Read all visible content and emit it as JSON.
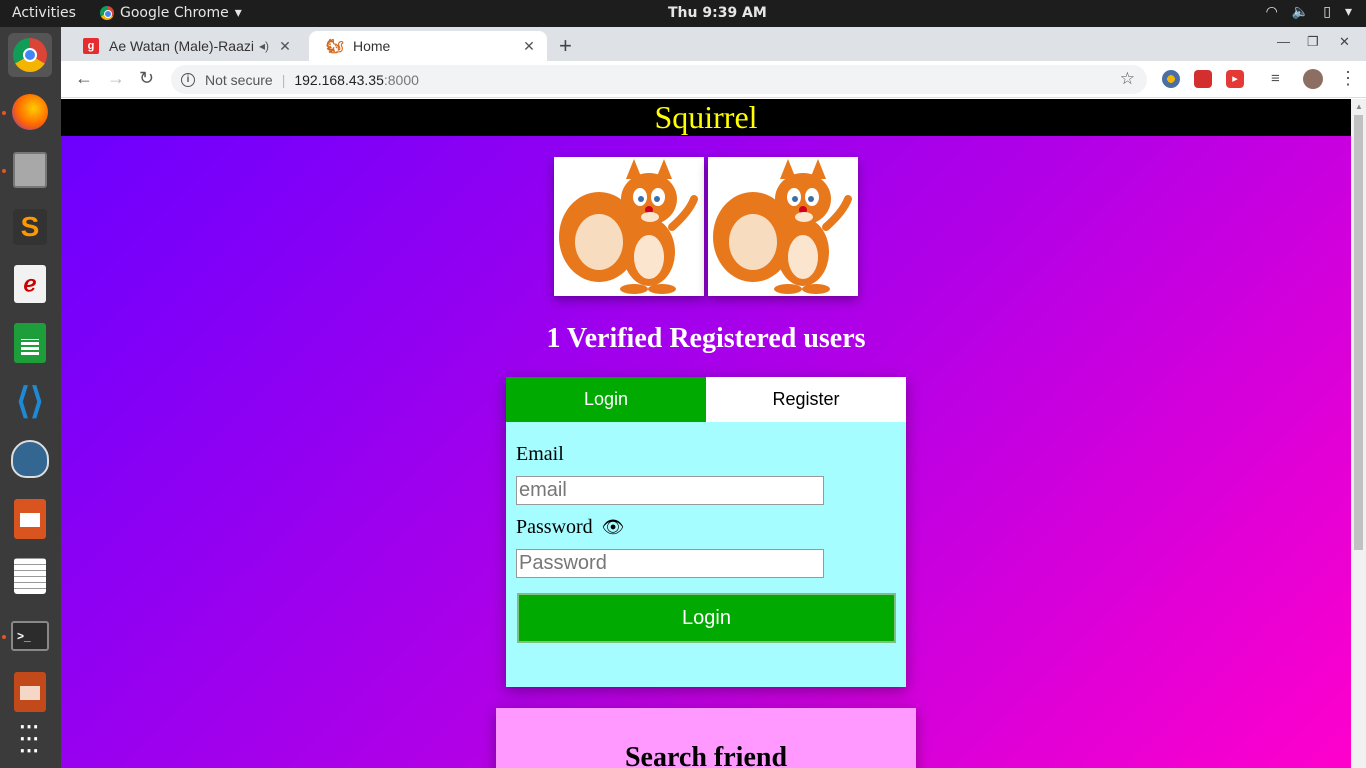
{
  "topbar": {
    "activities": "Activities",
    "app_name": "Google Chrome",
    "clock": "Thu  9:39 AM"
  },
  "browser": {
    "tabs": [
      {
        "title": "Ae Watan (Male)-Raazi",
        "favicon": "gaana-icon",
        "audio": true
      },
      {
        "title": "Home",
        "favicon": "squirrel-icon",
        "active": true
      }
    ],
    "address": {
      "security": "Not secure",
      "host": "192.168.43.35",
      "port": ":8000"
    }
  },
  "site": {
    "title": "Squirrel",
    "users_count_text": "1 Verified Registered users",
    "auth": {
      "tab_login": "Login",
      "tab_register": "Register",
      "email_label": "Email",
      "email_placeholder": "email",
      "password_label": "Password",
      "password_placeholder": "Password",
      "login_button": "Login"
    },
    "search_title": "Search friend"
  },
  "colors": {
    "header_bg": "#000000",
    "header_text": "#ffff00",
    "accent_green": "#00aa00",
    "auth_bg": "#a6fdff",
    "search_bg": "#ff99ff"
  }
}
